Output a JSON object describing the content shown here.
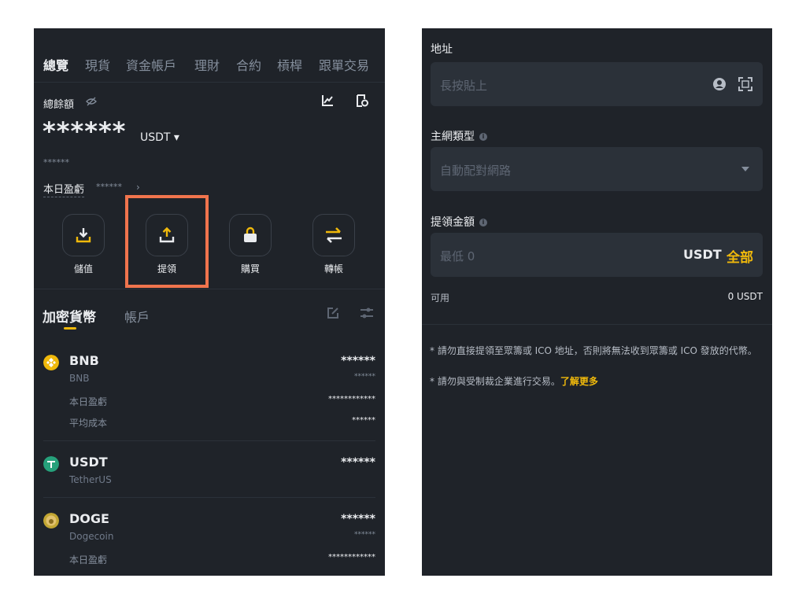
{
  "left": {
    "nav_tabs": [
      "總覽",
      "現貨",
      "資金帳戶",
      "理財",
      "合約",
      "槓桿",
      "跟單交易"
    ],
    "balance": {
      "label": "總餘額",
      "masked_value": "******",
      "currency": "USDT",
      "masked_sub": "******",
      "pnl_label": "本日盈虧",
      "pnl_value": "******"
    },
    "actions": [
      "儲值",
      "提領",
      "購買",
      "轉帳"
    ],
    "section_tabs": [
      "加密貨幣",
      "帳戶"
    ],
    "coins": [
      {
        "symbol": "BNB",
        "name": "BNB",
        "value": "******",
        "sub_value": "******",
        "rows": [
          {
            "label": "本日盈虧",
            "value": "************"
          },
          {
            "label": "平均成本",
            "value": "******"
          }
        ]
      },
      {
        "symbol": "USDT",
        "name": "TetherUS",
        "value": "******"
      },
      {
        "symbol": "DOGE",
        "name": "Dogecoin",
        "value": "******",
        "sub_value": "******",
        "rows": [
          {
            "label": "本日盈虧",
            "value": "************"
          }
        ]
      }
    ]
  },
  "right": {
    "address": {
      "label": "地址",
      "placeholder": "長按貼上"
    },
    "network": {
      "label": "主網類型",
      "placeholder": "自動配對網路"
    },
    "amount": {
      "label": "提領金額",
      "placeholder": "最低 0",
      "currency": "USDT",
      "max_label": "全部"
    },
    "available": {
      "label": "可用",
      "value": "0 USDT"
    },
    "notes": {
      "line1": "* 請勿直接提領至眾籌或 ICO 地址，否則將無法收到眾籌或 ICO 發放的代幣。",
      "line2_prefix": "* 請勿與受制裁企業進行交易。",
      "line2_link": "了解更多"
    }
  },
  "colors": {
    "background": "#1f2329",
    "accent": "#f0b90b",
    "highlight_box": "#f0744d",
    "field_bg": "#2b3139"
  }
}
